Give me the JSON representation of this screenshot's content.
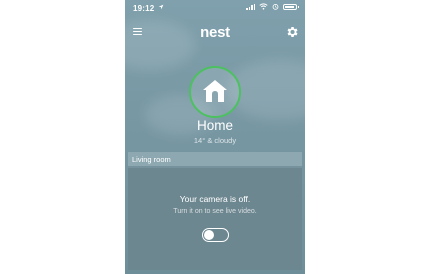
{
  "status_bar": {
    "time": "19:12",
    "location_icon": "location-arrow-icon",
    "signal_icon": "cellular-signal-icon",
    "wifi_icon": "wifi-icon",
    "alarm_icon": "alarm-icon",
    "battery_icon": "battery-icon"
  },
  "app_bar": {
    "menu_icon": "hamburger-menu-icon",
    "logo": "nest",
    "settings_icon": "gear-icon"
  },
  "structure": {
    "icon": "home-icon",
    "name": "Home",
    "weather": "14° & cloudy",
    "status_color": "#4cc15f"
  },
  "room": {
    "name": "Living room",
    "camera": {
      "status": "Your camera is off.",
      "hint": "Turn it on to see live video.",
      "toggle_on": false
    }
  },
  "colors": {
    "background": "#7898a4",
    "accent_green": "#4cc15f",
    "text": "#ffffff"
  }
}
